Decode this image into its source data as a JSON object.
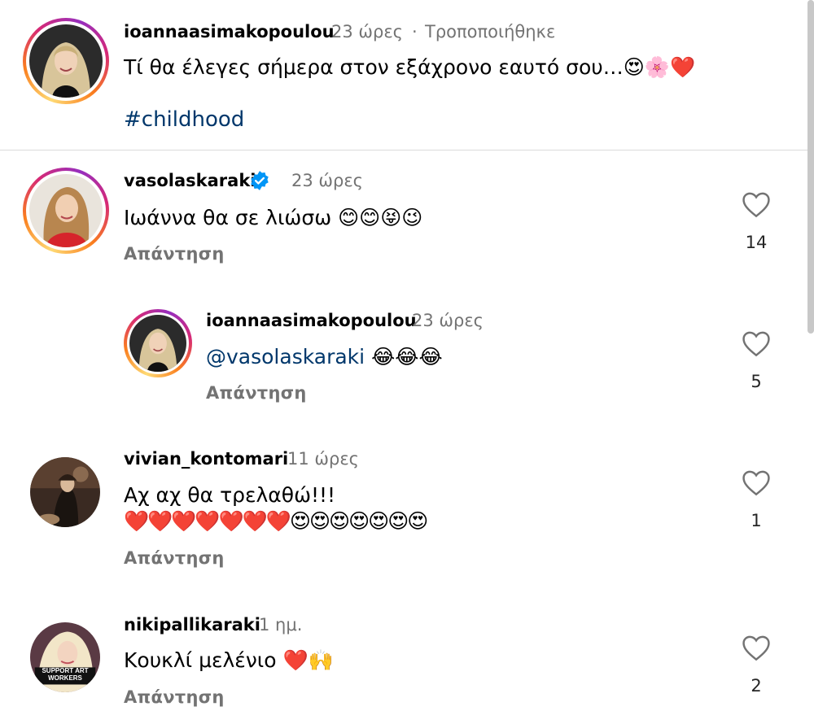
{
  "post": {
    "username": "ioannaasimakopoulou",
    "time": "23 ώρες",
    "separator": "·",
    "edited": "Τροποποιήθηκε",
    "caption": "Τί θα έλεγες σήμερα στον εξάχρονο εαυτό σου…",
    "caption_emojis": "😍🌸❤️",
    "hashtag": "#childhood"
  },
  "comments": [
    {
      "username": "vasolaskaraki",
      "verified": true,
      "time": "23 ώρες",
      "text": "Ιωάννα θα σε λιώσω",
      "emojis": "😊😊😝😉",
      "reply_label": "Απάντηση",
      "likes": "14"
    },
    {
      "username": "ioannaasimakopoulou",
      "time": "23 ώρες",
      "mention": "@vasolaskaraki",
      "emojis": "😂😂😂",
      "reply_label": "Απάντηση",
      "likes": "5"
    },
    {
      "username": "vivian_kontomari",
      "time": "11 ώρες",
      "text": "Αχ αχ θα τρελαθώ!!!",
      "emojis": "❤️❤️❤️❤️❤️❤️❤️😍😍😍😍😍😍😍",
      "reply_label": "Απάντηση",
      "likes": "1"
    },
    {
      "username": "nikipallikaraki",
      "time": "1 ημ.",
      "text": "Κουκλί μελένιο",
      "emojis": "❤️🙌",
      "reply_label": "Απάντηση",
      "likes": "2"
    }
  ],
  "avatar_badge_text": "SUPPORT ART WORKERS",
  "colors": {
    "link": "#00376b",
    "secondary": "#737373",
    "verified": "#0095f6",
    "heart_red": "#e8192c",
    "emoji_yellow": "#ffcc4d"
  }
}
